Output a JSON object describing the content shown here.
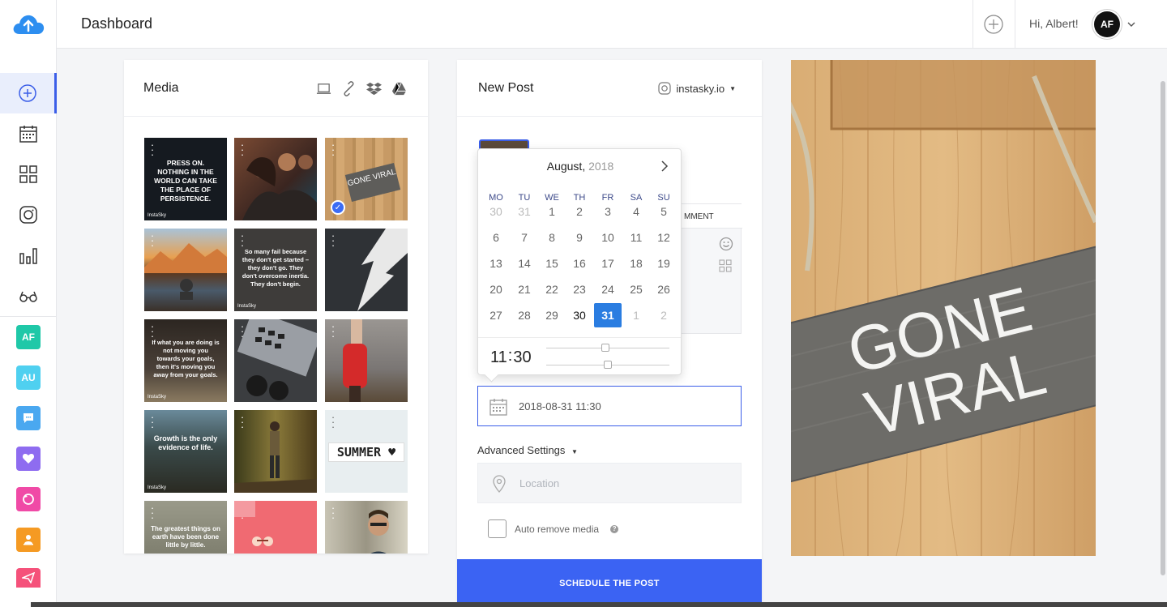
{
  "header": {
    "title": "Dashboard",
    "greeting": "Hi, Albert!",
    "avatar_initials": "AF"
  },
  "sidebar": {
    "nav": [
      "new-post",
      "calendar",
      "grid",
      "instagram",
      "analytics",
      "glasses"
    ],
    "accounts": [
      {
        "initials": "AF",
        "color": "#1fc8a8"
      },
      {
        "initials": "AU",
        "color": "#4fd0f0"
      },
      {
        "icon": "message-icon",
        "color": "#4aa8f0"
      },
      {
        "icon": "heart-icon",
        "color": "#8e6cf0"
      },
      {
        "icon": "refresh-icon",
        "color": "#f04aa6"
      },
      {
        "icon": "person-icon",
        "color": "#f59a23"
      },
      {
        "icon": "send-icon",
        "color": "#f5517a"
      }
    ]
  },
  "media": {
    "title": "Media",
    "tools": [
      "laptop-icon",
      "link-icon",
      "dropbox-icon",
      "drive-icon"
    ],
    "thumbs": [
      {
        "caption": "PRESS ON. NOTHING IN THE WORLD CAN TAKE THE PLACE OF PERSISTENCE.",
        "brand": "InstaSky",
        "bg": "#151a20"
      },
      {
        "caption": "",
        "brand": "",
        "bg": "#4a2e24"
      },
      {
        "caption": "GONE VIRAL",
        "brand": "",
        "bg": "#b98e59",
        "selected": true
      },
      {
        "caption": "",
        "brand": "",
        "bg": "#a96b45"
      },
      {
        "caption": "So many fail because they don't get started – they don't go. They don't overcome inertia. They don't begin.",
        "brand": "InstaSky",
        "bg": "#3e3c3a"
      },
      {
        "caption": "",
        "brand": "",
        "bg": "#2f3236"
      },
      {
        "caption": "If what you are doing is not moving you towards your goals, then it's moving you away from your goals.",
        "brand": "InstaSky",
        "bg": "#2c2621"
      },
      {
        "caption": "",
        "brand": "",
        "bg": "#3b3d40"
      },
      {
        "caption": "",
        "brand": "",
        "bg": "#8f8a86"
      },
      {
        "caption": "Growth is the only evidence of life.",
        "brand": "InstaSky",
        "bg": "#3a4a4a"
      },
      {
        "caption": "",
        "brand": "",
        "bg": "#5a4a2a"
      },
      {
        "caption": "SUMMER ♥",
        "brand": "",
        "bg": "#e8eef0"
      },
      {
        "caption": "The greatest things on earth have been done little by little.",
        "brand": "",
        "bg": "#707060"
      },
      {
        "caption": "",
        "brand": "",
        "bg": "#f06a72"
      },
      {
        "caption": "",
        "brand": "",
        "bg": "#9a9584"
      }
    ]
  },
  "post": {
    "title": "New Post",
    "account": "instasky.io",
    "comment_tab": "MMENT",
    "date_value": "2018-08-31 11:30",
    "advanced": "Advanced Settings",
    "location_placeholder": "Location",
    "auto_remove": "Auto remove media",
    "schedule_btn": "SCHEDULE THE POST"
  },
  "datepicker": {
    "month": "August,",
    "year": "2018",
    "weekdays": [
      "MO",
      "TU",
      "WE",
      "TH",
      "FR",
      "SA",
      "SU"
    ],
    "weeks": [
      [
        "30",
        "31",
        "1",
        "2",
        "3",
        "4",
        "5"
      ],
      [
        "6",
        "7",
        "8",
        "9",
        "10",
        "11",
        "12"
      ],
      [
        "13",
        "14",
        "15",
        "16",
        "17",
        "18",
        "19"
      ],
      [
        "20",
        "21",
        "22",
        "23",
        "24",
        "25",
        "26"
      ],
      [
        "27",
        "28",
        "29",
        "30",
        "31",
        "1",
        "2"
      ]
    ],
    "hour": "11",
    "minute": "30",
    "selected_day": "31",
    "hour_fraction": 0.48,
    "minute_fraction": 0.5
  },
  "preview": {
    "line1": "GONE",
    "line2": "VIRAL"
  },
  "colors": {
    "accent": "#3b5ee8",
    "button": "#3b63f3",
    "selected_day": "#2a7de1"
  }
}
